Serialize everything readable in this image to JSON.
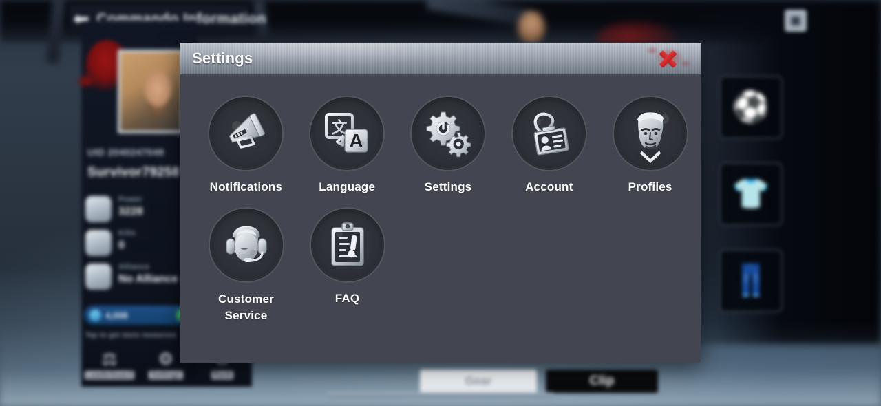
{
  "background": {
    "header": {
      "back_icon": "back-arrow-icon",
      "title": "Commando Information"
    },
    "character": {
      "uid_label": "UID 2040247049",
      "username": "Survivor79258",
      "stats": [
        {
          "icon": "gloves-icon",
          "label": "Power",
          "value": "3228"
        },
        {
          "icon": "backpack-icon",
          "label": "Kills",
          "value": "0"
        },
        {
          "icon": "alliance-icon",
          "label": "Alliance",
          "value": "No Alliance"
        }
      ],
      "credits": {
        "icon": "coin-icon",
        "value": "4,008",
        "plus_icon": "plus-icon",
        "sub_text": "Tap to get more resources"
      }
    },
    "bottom_tabs": [
      {
        "icon": "leaderboard-icon",
        "label": "Leaderboard"
      },
      {
        "icon": "settings-gear-icon",
        "label": "Settings"
      },
      {
        "icon": "rank-crown-icon",
        "label": "Rank"
      }
    ],
    "equipment_slots": [
      {
        "icon": "helmet-slot-icon"
      },
      {
        "icon": "vest-slot-icon"
      },
      {
        "icon": "pants-slot-icon"
      }
    ],
    "top_right_badge": "▣",
    "bottom_buttons": [
      {
        "name": "gear-button",
        "label": "Gear"
      },
      {
        "name": "clip-button",
        "label": "Clip"
      }
    ]
  },
  "modal": {
    "title": "Settings",
    "close_icon": "close-x-icon",
    "rows": [
      [
        {
          "id": "notifications",
          "label": "Notifications",
          "icon": "megaphone-icon"
        },
        {
          "id": "language",
          "label": "Language",
          "icon": "translate-icon"
        },
        {
          "id": "settings",
          "label": "Settings",
          "icon": "gears-icon"
        },
        {
          "id": "account",
          "label": "Account",
          "icon": "id-badge-icon"
        },
        {
          "id": "profiles",
          "label": "Profiles",
          "icon": "avatar-portrait-icon"
        }
      ],
      [
        {
          "id": "customer-service",
          "label": "Customer\nService",
          "label_line1": "Customer",
          "label_line2": "Service",
          "icon": "headset-agent-icon"
        },
        {
          "id": "faq",
          "label": "FAQ",
          "icon": "clipboard-exclamation-icon"
        }
      ]
    ]
  },
  "colors": {
    "modal_body": "#434650",
    "titlebar_top": "#c2c8d0",
    "titlebar_bottom": "#6f7884",
    "icon_circle": "#2e3139",
    "icon_border": "#53565f",
    "label_text": "#ffffff",
    "close_red": "#d4302f"
  }
}
